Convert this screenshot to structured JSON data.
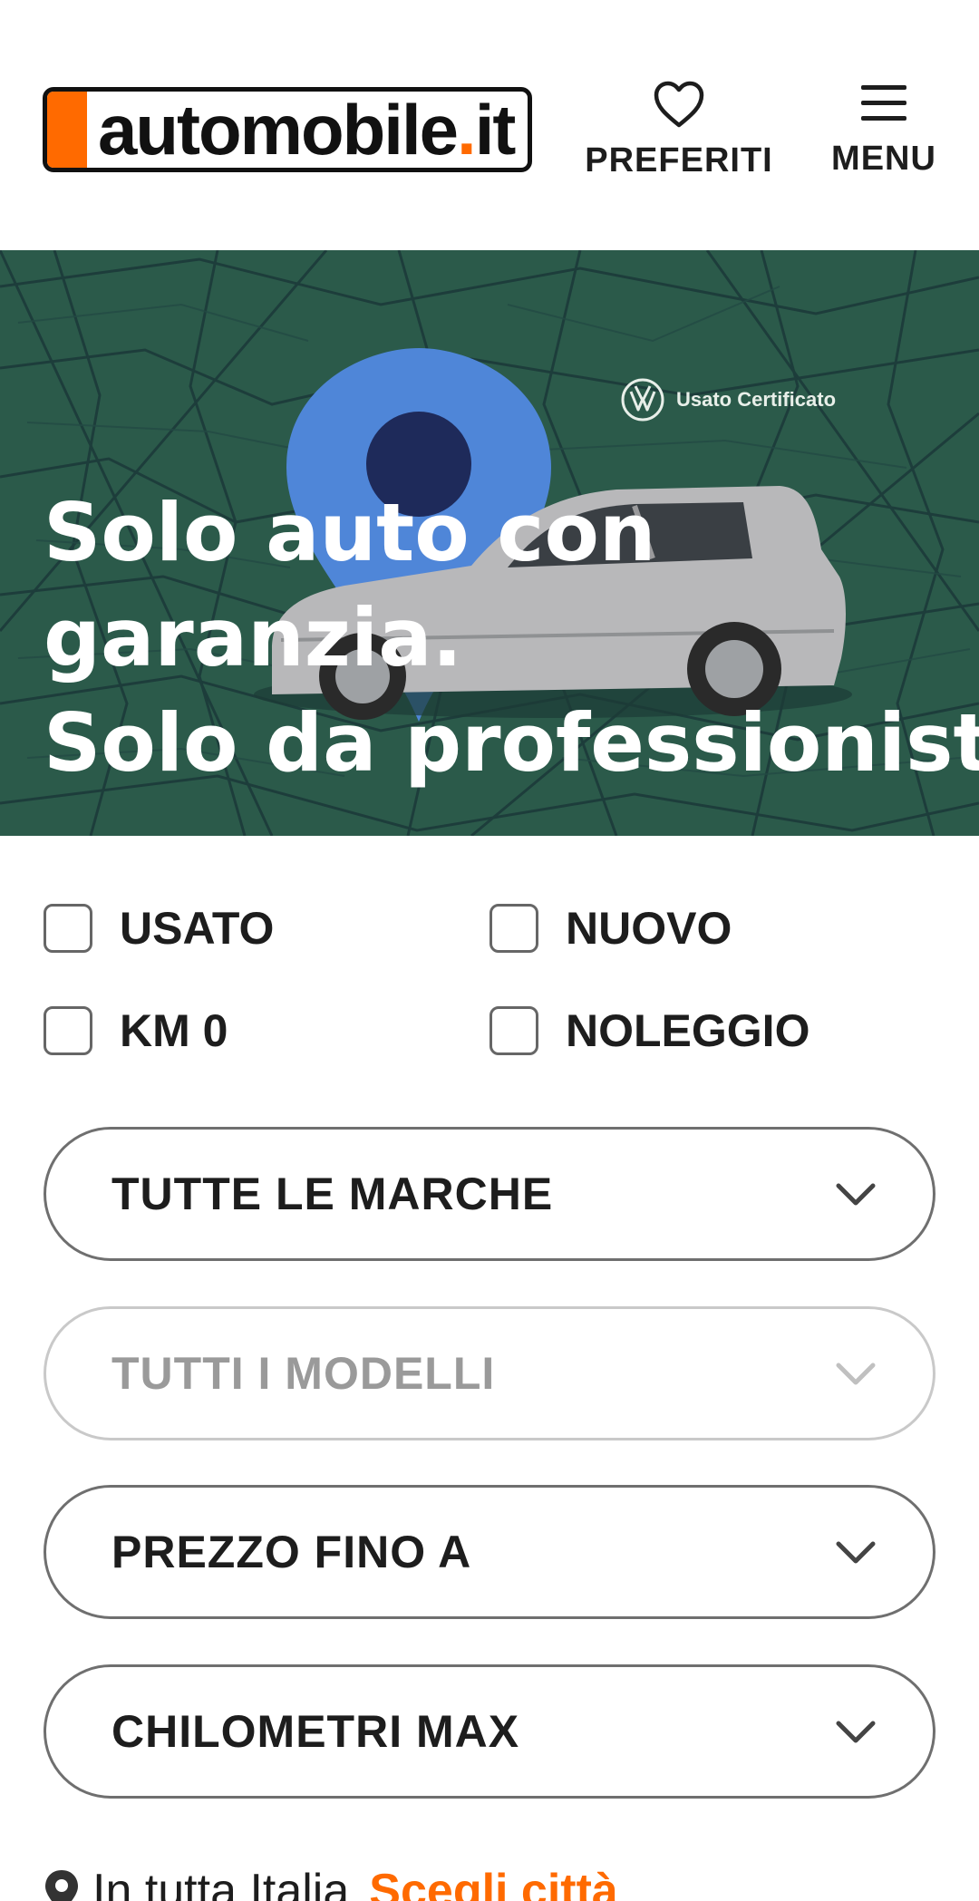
{
  "header": {
    "logo": {
      "text_main": "automobile",
      "text_dot": ".",
      "text_tld": "it"
    },
    "favorites_label": "PREFERITI",
    "menu_label": "MENU"
  },
  "hero": {
    "badge_text": "Usato Certificato",
    "title_lines": [
      "Solo auto con",
      "garanzia.",
      "Solo da professionisti"
    ]
  },
  "filters": {
    "checkboxes": [
      {
        "label": "USATO",
        "checked": false
      },
      {
        "label": "NUOVO",
        "checked": false
      },
      {
        "label": "KM 0",
        "checked": false
      },
      {
        "label": "NOLEGGIO",
        "checked": false
      }
    ],
    "selects": [
      {
        "value": "TUTTE LE MARCHE",
        "disabled": false
      },
      {
        "value": "TUTTI I MODELLI",
        "disabled": true
      },
      {
        "value": "PREZZO FINO A",
        "disabled": false
      },
      {
        "value": "CHILOMETRI MAX",
        "disabled": false
      }
    ]
  },
  "location": {
    "current": "In tutta Italia",
    "action": "Scegli città"
  },
  "colors": {
    "brand_orange": "#ff6a00",
    "hero_bg": "#2b5a4a",
    "pin_blue": "#4f86d8"
  },
  "icons": {
    "favorites": "heart-icon",
    "menu": "hamburger-icon",
    "select": "chevron-down-icon",
    "location": "map-pin-icon"
  }
}
